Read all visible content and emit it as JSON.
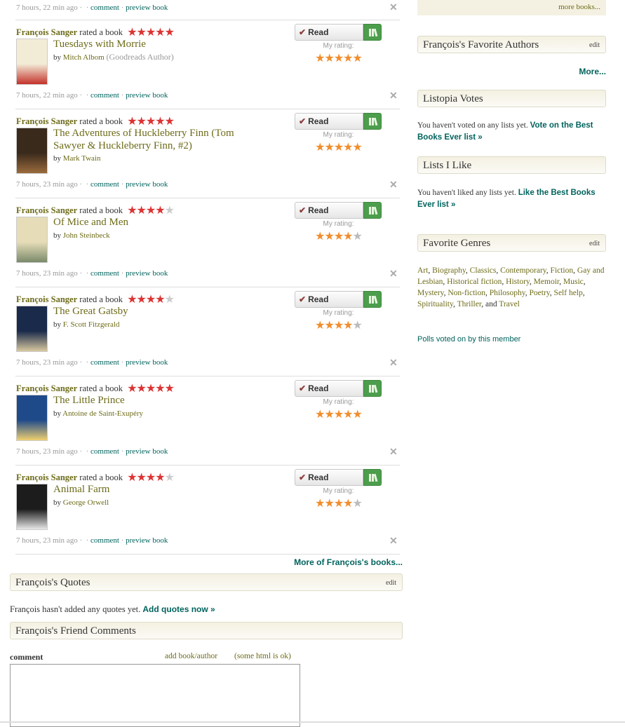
{
  "first_meta": {
    "time": "7 hours, 22 min ago",
    "comment": "comment",
    "preview": "preview book"
  },
  "user_name": "François Sanger",
  "action_text": "rated a book",
  "read_label": "Read",
  "my_rating_label": "My rating:",
  "updates": [
    {
      "title": "Tuesdays with Morrie",
      "title_line2": "",
      "author": "Mitch Albom",
      "author_note": "(Goodreads Author)",
      "rating": 5,
      "time": "7 hours, 22 min ago",
      "comment": "comment",
      "preview": "preview book",
      "cover_color": "#f2ebd6",
      "cover_accent": "#c4322b"
    },
    {
      "title": "The Adventures of Huckleberry Finn (Tom",
      "title_line2": "Sawyer & Huckleberry Finn, #2)",
      "author": "Mark Twain",
      "author_note": "",
      "rating": 5,
      "time": "7 hours, 23 min ago",
      "comment": "comment",
      "preview": "preview book",
      "cover_color": "#3a2a1c",
      "cover_accent": "#9a6b3c"
    },
    {
      "title": "Of Mice and Men",
      "title_line2": "",
      "author": "John Steinbeck",
      "author_note": "",
      "rating": 4,
      "time": "7 hours, 23 min ago",
      "comment": "comment",
      "preview": "preview book",
      "cover_color": "#e6dcb8",
      "cover_accent": "#7a8a6a"
    },
    {
      "title": "The Great Gatsby",
      "title_line2": "",
      "author": "F. Scott Fitzgerald",
      "author_note": "",
      "rating": 4,
      "time": "7 hours, 23 min ago",
      "comment": "comment",
      "preview": "preview book",
      "cover_color": "#1a2a4a",
      "cover_accent": "#d9c9a0"
    },
    {
      "title": "The Little Prince",
      "title_line2": "",
      "author": "Antoine de Saint-Exupéry",
      "author_note": "",
      "rating": 5,
      "time": "7 hours, 23 min ago",
      "comment": "comment",
      "preview": "preview book",
      "cover_color": "#1f4a8a",
      "cover_accent": "#f0d070"
    },
    {
      "title": "Animal Farm",
      "title_line2": "",
      "author": "George Orwell",
      "author_note": "",
      "rating": 4,
      "time": "7 hours, 23 min ago",
      "comment": "comment",
      "preview": "preview book",
      "cover_color": "#1c1c1c",
      "cover_accent": "#e8e8e8"
    }
  ],
  "more_books_link": "More of François's books...",
  "quotes": {
    "heading": "François's Quotes",
    "edit": "edit",
    "empty": "François hasn't added any quotes yet.",
    "cta": "Add quotes now »"
  },
  "friend_comments": {
    "heading": "François's Friend Comments",
    "label": "comment",
    "add_link": "add book/author",
    "html_note": "(some html is ok)"
  },
  "sidebar": {
    "more_books": "more books...",
    "favorite_authors": {
      "heading": "François's Favorite Authors",
      "edit": "edit",
      "more": "More..."
    },
    "listopia": {
      "heading": "Listopia Votes",
      "text": "You haven't voted on any lists yet.",
      "cta": "Vote on the Best Books Ever list »"
    },
    "lists_like": {
      "heading": "Lists I Like",
      "text": "You haven't liked any lists yet.",
      "cta": "Like the Best Books Ever list »"
    },
    "genres": {
      "heading": "Favorite Genres",
      "edit": "edit",
      "items": [
        "Art",
        "Biography",
        "Classics",
        "Contemporary",
        "Fiction",
        "Gay and Lesbian",
        "Historical fiction",
        "History",
        "Memoir",
        "Music",
        "Mystery",
        "Non-fiction",
        "Philosophy",
        "Poetry",
        "Self help",
        "Spirituality",
        "Thriller",
        "Travel"
      ]
    },
    "polls": "Polls voted on by this member"
  },
  "colors": {
    "name_olive": "#6d6b18",
    "link_green": "#00635d",
    "star_red": "#dd3333",
    "rating_orange": "#f18d2c"
  }
}
